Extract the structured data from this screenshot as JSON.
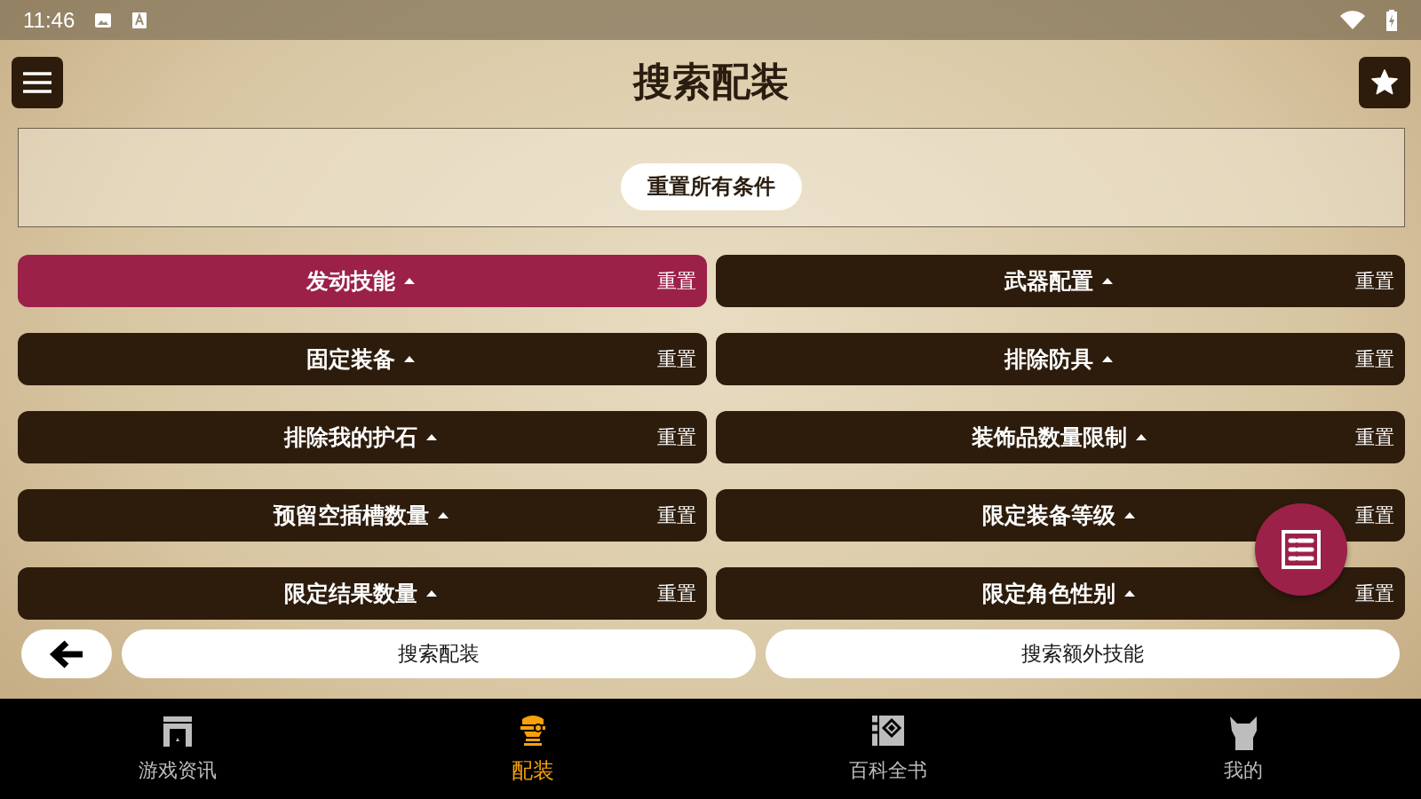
{
  "status_bar": {
    "time": "11:46"
  },
  "header": {
    "title": "搜索配装"
  },
  "reset_all": {
    "label": "重置所有条件"
  },
  "filters": [
    {
      "label": "发动技能",
      "reset": "重置",
      "selected": true
    },
    {
      "label": "武器配置",
      "reset": "重置",
      "selected": false
    },
    {
      "label": "固定装备",
      "reset": "重置",
      "selected": false
    },
    {
      "label": "排除防具",
      "reset": "重置",
      "selected": false
    },
    {
      "label": "排除我的护石",
      "reset": "重置",
      "selected": false
    },
    {
      "label": "装饰品数量限制",
      "reset": "重置",
      "selected": false
    },
    {
      "label": "预留空插槽数量",
      "reset": "重置",
      "selected": false
    },
    {
      "label": "限定装备等级",
      "reset": "重置",
      "selected": false
    },
    {
      "label": "限定结果数量",
      "reset": "重置",
      "selected": false
    },
    {
      "label": "限定角色性别",
      "reset": "重置",
      "selected": false
    }
  ],
  "actions": [
    "搜索配装",
    "搜索额外技能"
  ],
  "bottom_nav": [
    {
      "label": "游戏资讯",
      "kind": "news",
      "selected": false
    },
    {
      "label": "配装",
      "kind": "build",
      "selected": true
    },
    {
      "label": "百科全书",
      "kind": "wiki",
      "selected": false
    },
    {
      "label": "我的",
      "kind": "me",
      "selected": false
    }
  ]
}
